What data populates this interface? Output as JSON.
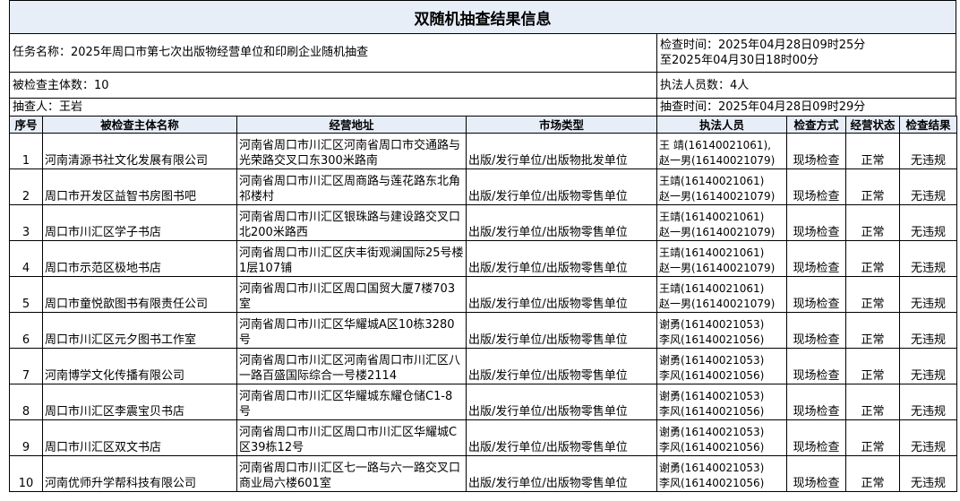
{
  "title": "双随机抽查结果信息",
  "info": {
    "task": "任务名称：2025年周口市第七次出版物经营单位和印刷企业随机抽查",
    "check_time_line1": "检查时间：2025年04月28日09时25分",
    "check_time_line2": "至2025年04月30日18时00分",
    "subject_count": "被检查主体数：10",
    "officer_count": "执法人员数：4人",
    "sampler": "抽查人：王岩",
    "sample_time": "抽查时间：2025年04月28日09时29分"
  },
  "columns": [
    "序号",
    "被检查主体名称",
    "经营地址",
    "市场类型",
    "执法人员",
    "检查方式",
    "经营状态",
    "检查结果"
  ],
  "rows": [
    {
      "no": "1",
      "name": "河南清源书社文化发展有限公司",
      "address": "河南省周口市川汇区河南省周口市交通路与光荣路交叉口东300米路南",
      "market": "出版/发行单位/出版物批发单位",
      "insp1": "王 靖(16140021061),",
      "insp2": "赵一男(16140021079)",
      "method": "现场检查",
      "status": "正常",
      "result": "无违规"
    },
    {
      "no": "2",
      "name": "周口市开发区益智书房图书吧",
      "address": "河南省周口市川汇区周商路与莲花路东北角祁楼村",
      "market": "出版/发行单位/出版物零售单位",
      "insp1": "王靖(16140021061)",
      "insp2": "赵一男(16140021079)",
      "method": "现场检查",
      "status": "正常",
      "result": "无违规"
    },
    {
      "no": "3",
      "name": "周口市川汇区学子书店",
      "address": "河南省周口市川汇区银珠路与建设路交叉口北200米路西",
      "market": "出版/发行单位/出版物零售单位",
      "insp1": "王靖(16140021061)",
      "insp2": "赵一男(16140021079)",
      "method": "现场检查",
      "status": "正常",
      "result": "无违规"
    },
    {
      "no": "4",
      "name": "周口市示范区极地书店",
      "address": "河南省周口市川汇区庆丰街观澜国际25号楼1层107铺",
      "market": "出版/发行单位/出版物零售单位",
      "insp1": "王靖(16140021061)",
      "insp2": "赵一男(16140021079)",
      "method": "现场检查",
      "status": "正常",
      "result": "无违规"
    },
    {
      "no": "5",
      "name": "周口市童悦歆图书有限责任公司",
      "address": "河南省周口市川汇区周口国贸大厦7楼703室",
      "market": "出版/发行单位/出版物零售单位",
      "insp1": "王靖(16140021061)",
      "insp2": "赵一男(16140021079)",
      "method": "现场检查",
      "status": "正常",
      "result": "无违规"
    },
    {
      "no": "6",
      "name": "周口市川汇区元夕图书工作室",
      "address": "河南省周口市川汇区华耀城A区10栋3280号",
      "market": "出版/发行单位/出版物零售单位",
      "insp1": "谢勇(16140021053)",
      "insp2": "李风(16140021056)",
      "method": "现场检查",
      "status": "正常",
      "result": "无违规"
    },
    {
      "no": "7",
      "name": "河南博学文化传播有限公司",
      "address": "河南省周口市川汇区河南省周口市川汇区八一路百盛国际综合一号楼2114",
      "market": "出版/发行单位/出版物零售单位",
      "insp1": "谢勇(16140021053)",
      "insp2": "李风(16140021056)",
      "method": "现场检查",
      "status": "正常",
      "result": "无违规"
    },
    {
      "no": "8",
      "name": "周口市川汇区李震宝贝书店",
      "address": "河南省周口市川汇区华耀城东耀仓储C1-8号",
      "market": "出版/发行单位/出版物零售单位",
      "insp1": "谢勇(16140021053)",
      "insp2": "李风(16140021056)",
      "method": "现场检查",
      "status": "正常",
      "result": "无违规"
    },
    {
      "no": "9",
      "name": "周口市川汇区双文书店",
      "address": "河南省周口市川汇区周口市川汇区华耀城C区39栋12号",
      "market": "出版/发行单位/出版物零售单位",
      "insp1": "谢勇(16140021053)",
      "insp2": "李风(16140021056)",
      "method": "现场检查",
      "status": "正常",
      "result": "无违规"
    },
    {
      "no": "10",
      "name": "河南优师升学帮科技有限公司",
      "address": "河南省周口市川汇区七一路与六一路交叉口商业局六楼601室",
      "market": "出版/发行单位/出版物零售单位",
      "insp1": "谢勇(16140021053)",
      "insp2": "李风(16140021056)",
      "method": "现场检查",
      "status": "正常",
      "result": "无违规"
    }
  ],
  "colors": {
    "header_bg": "#e7eef8",
    "border": "#000000"
  }
}
